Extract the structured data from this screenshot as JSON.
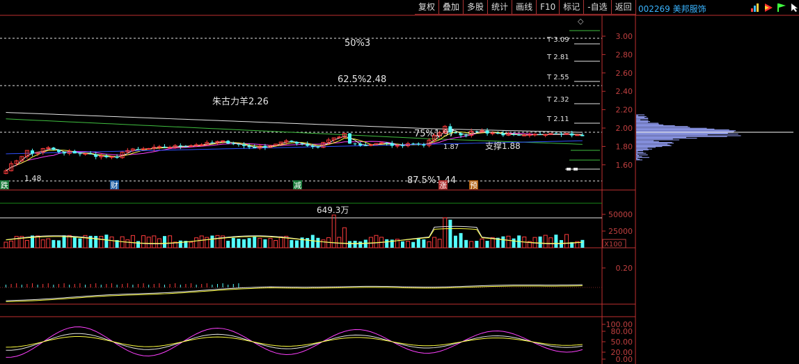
{
  "toolbar": {
    "buttons": [
      "复权",
      "叠加",
      "多股",
      "统计",
      "画线",
      "F10",
      "标记",
      "-自选",
      "返回"
    ]
  },
  "stock": {
    "title": "002269 美邦服饰"
  },
  "main": {
    "y_ticks": [
      "3.00",
      "2.80",
      "2.60",
      "2.40",
      "2.20",
      "2.00",
      "1.80",
      "1.60"
    ],
    "levels": [
      {
        "label": "50%3",
        "value": 3.0
      },
      {
        "label": "62.5%2.48",
        "value": 2.48
      },
      {
        "label": "75%1.97",
        "value": 1.97
      },
      {
        "label": "87.5%1.44",
        "value": 1.44
      }
    ],
    "target_labels": [
      "T 3.09",
      "T 2.81",
      "T 2.55",
      "T 2.32",
      "T 2.11"
    ],
    "annotations": {
      "zhugu": "朱古力羊2.26",
      "support": "支撑1.88",
      "low": "1.48",
      "mid": "1.87"
    },
    "event_markers": [
      {
        "text": "跌",
        "color": "#1a7a3a"
      },
      {
        "text": "财",
        "color": "#1a5aa0"
      },
      {
        "text": "减",
        "color": "#1a7a3a"
      },
      {
        "text": "涨",
        "color": "#b03030"
      },
      {
        "text": "预",
        "color": "#b06010"
      }
    ],
    "marker_symbol": "◇"
  },
  "volume": {
    "max_label": "649.3万",
    "y_ticks": [
      "50000",
      "25000"
    ],
    "unit": "X100"
  },
  "indicator1": {
    "y_ticks": [
      "0.20"
    ]
  },
  "indicator2": {
    "y_ticks": [
      "100.00",
      "80.00",
      "50.00",
      "20.00",
      "0.00"
    ]
  },
  "colors": {
    "up": "#ff3c3c",
    "down": "#54fcfc",
    "ma_white": "#e6e6e6",
    "ma_yellow": "#ffff40",
    "ma_magenta": "#ff40ff",
    "ma_green": "#40c040",
    "line_blue": "#3050ff",
    "axis": "#c03030",
    "profile": "#9aa6ff"
  }
}
